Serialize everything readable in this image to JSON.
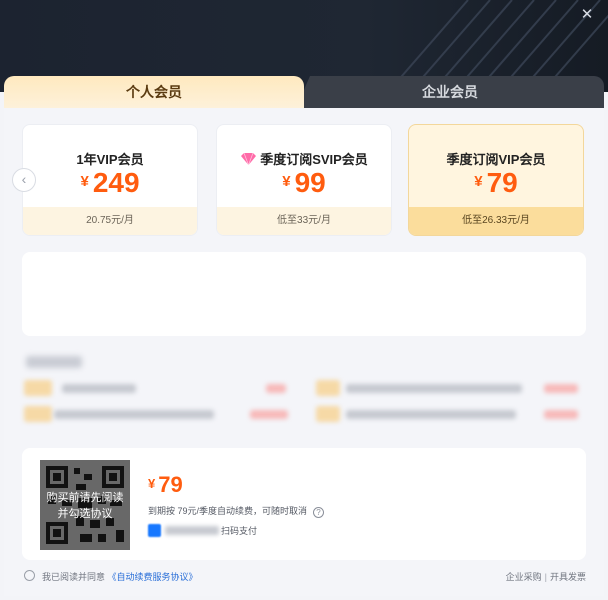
{
  "window": {
    "close_glyph": "✕"
  },
  "tabs": {
    "personal": "个人会员",
    "enterprise": "企业会员"
  },
  "nav": {
    "prev_glyph": "‹"
  },
  "plans": [
    {
      "name": "1年VIP会员",
      "currency": "¥",
      "price": "249",
      "note": "20.75元/月",
      "selected": false
    },
    {
      "name": "季度订阅SVIP会员",
      "badge": "SVIP",
      "currency": "¥",
      "price": "99",
      "note": "低至33元/月",
      "selected": false
    },
    {
      "name": "季度订阅VIP会员",
      "currency": "¥",
      "price": "79",
      "note": "低至26.33元/月",
      "selected": true
    }
  ],
  "payment": {
    "qr_overlay_line1": "购买前请先阅读",
    "qr_overlay_line2": "并勾选协议",
    "currency": "¥",
    "price": "79",
    "renew_note": "到期按 79元/季度自动续费，可随时取消",
    "help_glyph": "?",
    "method_suffix": "扫码支付"
  },
  "footer": {
    "agree_prefix": "我已阅读并同意",
    "agree_link": "《自动续费服务协议》",
    "link_enterprise": "企业采购",
    "separator": "|",
    "link_invoice": "开具发票"
  },
  "colors": {
    "price_orange": "#ff5c0f",
    "selected_plan_bg": "#fff5df",
    "selected_plan_footer": "#fbdd9c",
    "hero_dark": "#1c2330",
    "link_blue": "#2a6fd8"
  },
  "icons": [
    "close-icon",
    "chevron-left-icon",
    "svip-diamond-icon",
    "qr-code-icon",
    "help-icon",
    "alipay-icon",
    "radio-icon"
  ]
}
